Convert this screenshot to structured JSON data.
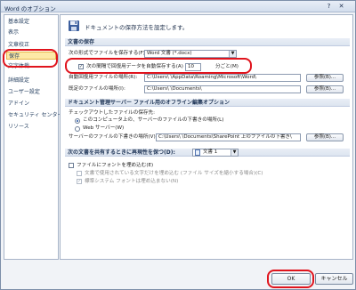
{
  "window": {
    "title": "Word のオプション",
    "help_glyph": "?",
    "close_glyph": "✕"
  },
  "sidebar": {
    "items": [
      {
        "label": "基本設定"
      },
      {
        "label": "表示"
      },
      {
        "label": "文章校正"
      },
      {
        "label": "保存",
        "active": true
      },
      {
        "label": "文字体裁"
      },
      {
        "label": "詳細設定"
      },
      {
        "label": "ユーザー設定"
      },
      {
        "label": "アドイン"
      },
      {
        "label": "セキュリティ センター"
      },
      {
        "label": "リソース"
      }
    ]
  },
  "header": {
    "text": "ドキュメントの保存方法を設定します。"
  },
  "save_section": {
    "title": "文書の保存",
    "format_label": "次の形式でファイルを保存する(F):",
    "format_value": "Word 文書 (*.docx)",
    "autosave_label": "次の間隔で回復用データを自動保存する(A)",
    "autosave_checked": "✓",
    "autosave_minutes": "10",
    "autosave_unit": "分ごと(M)",
    "recovery_label": "自動回復用ファイルの場所(R):",
    "recovery_path": "C:\\Users\\        \\AppData\\Roaming\\Microsoft\\Word\\",
    "default_label": "既定のファイルの場所(I):",
    "default_path": "C:\\Users\\        \\Documents\\",
    "browse_label": "参照(B)..."
  },
  "offline_section": {
    "title": "ドキュメント管理サーバー ファイル用のオフライン編集オプション",
    "checkout_label": "チェックアウトしたファイルの保存先:",
    "option_local": "このコンピュータ上の、サーバーのファイルの下書きの場所(L)",
    "option_web": "Web サーバー(W)",
    "drafts_label": "サーバーのファイルの下書きの場所(V):",
    "drafts_path": "C:\\Users\\        \\Documents\\SharePoint 上のファイルの下書き\\",
    "browse_label": "参照(B)..."
  },
  "share_section": {
    "title": "次の文書を共有するときに再現性を保つ(D):",
    "doc_value": "文書 1",
    "embed_fonts_label": "ファイルにフォントを埋め込む(E)",
    "embed_used_only_label": "文書で使用されている文字だけを埋め込む (ファイル サイズを縮小する場合)(C)",
    "no_system_fonts_label": "標準システム フォントは埋め込まない(N)"
  },
  "footer": {
    "ok_label": "OK",
    "cancel_label": "キャンセル"
  },
  "colors": {
    "highlight_oval": "#e0141d",
    "active_item": "#fde9a7"
  }
}
